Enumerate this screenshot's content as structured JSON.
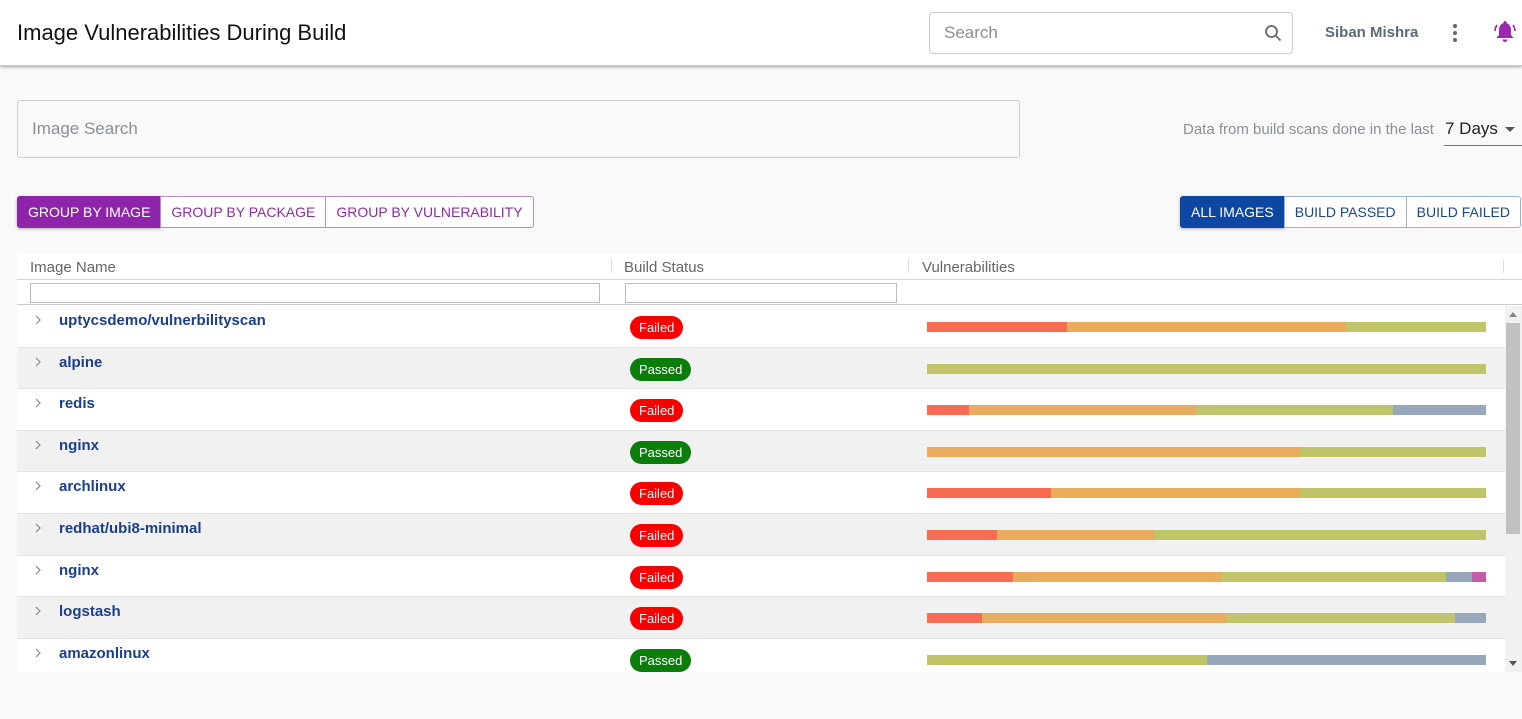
{
  "header": {
    "title": "Image Vulnerabilities During Build",
    "search_placeholder": "Search",
    "user_name": "Siban Mishra",
    "icons": [
      "search-icon",
      "more-vert-icon",
      "notification-bell-icon"
    ]
  },
  "image_search": {
    "placeholder": "Image Search",
    "value": ""
  },
  "time_range": {
    "label": "Data from build scans done in the last",
    "selected": "7 Days"
  },
  "group_by": {
    "options": [
      "GROUP BY IMAGE",
      "GROUP BY PACKAGE",
      "GROUP BY VULNERABILITY"
    ],
    "active": "GROUP BY IMAGE"
  },
  "build_filter": {
    "options": [
      "ALL IMAGES",
      "BUILD PASSED",
      "BUILD FAILED"
    ],
    "active": "ALL IMAGES"
  },
  "colors": {
    "critical": "#f76c52",
    "high": "#e9ac5c",
    "medium": "#c0c56a",
    "low": "#97a8ba",
    "unknown": "#c85ba6",
    "failed": "#f60000",
    "passed": "#0b7d0b",
    "group_accent": "#8e24aa",
    "filter_accent": "#0d47a1"
  },
  "table": {
    "columns": [
      "Image Name",
      "Build Status",
      "Vulnerabilities"
    ],
    "filters": {
      "image_name": "",
      "build_status": ""
    },
    "rows": [
      {
        "name": "uptycsdemo/vulnerbilityscan",
        "status": "Failed",
        "vuln_pct": {
          "critical": 25,
          "high": 50,
          "medium": 25,
          "low": 0,
          "unknown": 0
        }
      },
      {
        "name": "alpine",
        "status": "Passed",
        "vuln_pct": {
          "critical": 0,
          "high": 0,
          "medium": 100,
          "low": 0,
          "unknown": 0
        }
      },
      {
        "name": "redis",
        "status": "Failed",
        "vuln_pct": {
          "critical": 7.5,
          "high": 40.6,
          "medium": 35.2,
          "low": 16.7,
          "unknown": 0
        }
      },
      {
        "name": "nginx",
        "status": "Passed",
        "vuln_pct": {
          "critical": 0,
          "high": 66.7,
          "medium": 33.3,
          "low": 0,
          "unknown": 0
        }
      },
      {
        "name": "archlinux",
        "status": "Failed",
        "vuln_pct": {
          "critical": 22.2,
          "high": 44.5,
          "medium": 33.3,
          "low": 0,
          "unknown": 0
        }
      },
      {
        "name": "redhat/ubi8-minimal",
        "status": "Failed",
        "vuln_pct": {
          "critical": 12.5,
          "high": 28.1,
          "medium": 59.4,
          "low": 0,
          "unknown": 0
        }
      },
      {
        "name": "nginx",
        "status": "Failed",
        "vuln_pct": {
          "critical": 15.4,
          "high": 37.4,
          "medium": 40.1,
          "low": 4.6,
          "unknown": 2.5
        }
      },
      {
        "name": "logstash",
        "status": "Failed",
        "vuln_pct": {
          "critical": 9.8,
          "high": 43.8,
          "medium": 40.8,
          "low": 5.6,
          "unknown": 0
        }
      },
      {
        "name": "amazonlinux",
        "status": "Passed",
        "vuln_pct": {
          "critical": 0,
          "high": 0,
          "medium": 50,
          "low": 50,
          "unknown": 0
        }
      }
    ]
  }
}
